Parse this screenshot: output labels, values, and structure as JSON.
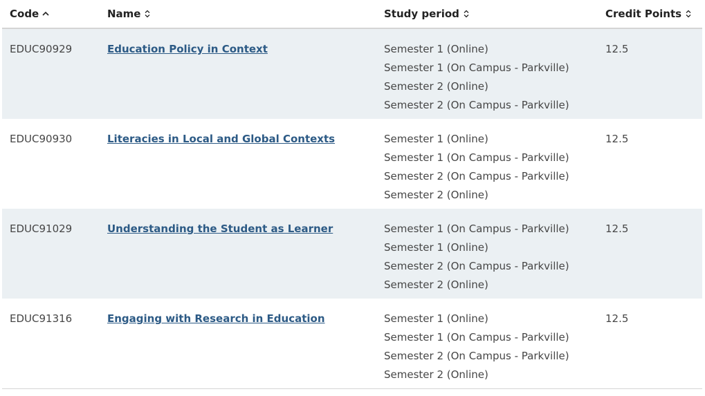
{
  "table": {
    "headers": {
      "code": "Code",
      "name": "Name",
      "study_period": "Study period",
      "credit_points": "Credit Points"
    },
    "sort": {
      "code": "ascending",
      "name": "none",
      "study_period": "none",
      "credit_points": "none"
    },
    "rows": [
      {
        "code": "EDUC90929",
        "name": "Education Policy in Context",
        "periods": [
          "Semester 1 (Online)",
          "Semester 1 (On Campus - Parkville)",
          "Semester 2 (Online)",
          "Semester 2 (On Campus - Parkville)"
        ],
        "credits": "12.5"
      },
      {
        "code": "EDUC90930",
        "name": "Literacies in Local and Global Contexts",
        "periods": [
          "Semester 1 (Online)",
          "Semester 1 (On Campus - Parkville)",
          "Semester 2 (On Campus - Parkville)",
          "Semester 2 (Online)"
        ],
        "credits": "12.5"
      },
      {
        "code": "EDUC91029",
        "name": "Understanding the Student as Learner",
        "periods": [
          "Semester 1 (On Campus - Parkville)",
          "Semester 1 (Online)",
          "Semester 2 (On Campus - Parkville)",
          "Semester 2 (Online)"
        ],
        "credits": "12.5"
      },
      {
        "code": "EDUC91316",
        "name": "Engaging with Research in Education",
        "periods": [
          "Semester 1 (Online)",
          "Semester 1 (On Campus - Parkville)",
          "Semester 2 (On Campus - Parkville)",
          "Semester 2 (Online)"
        ],
        "credits": "12.5"
      }
    ]
  },
  "colors": {
    "link": "#2c5a85",
    "row_shade": "#ebf0f3",
    "header_text": "#222222",
    "body_text": "#464646"
  }
}
